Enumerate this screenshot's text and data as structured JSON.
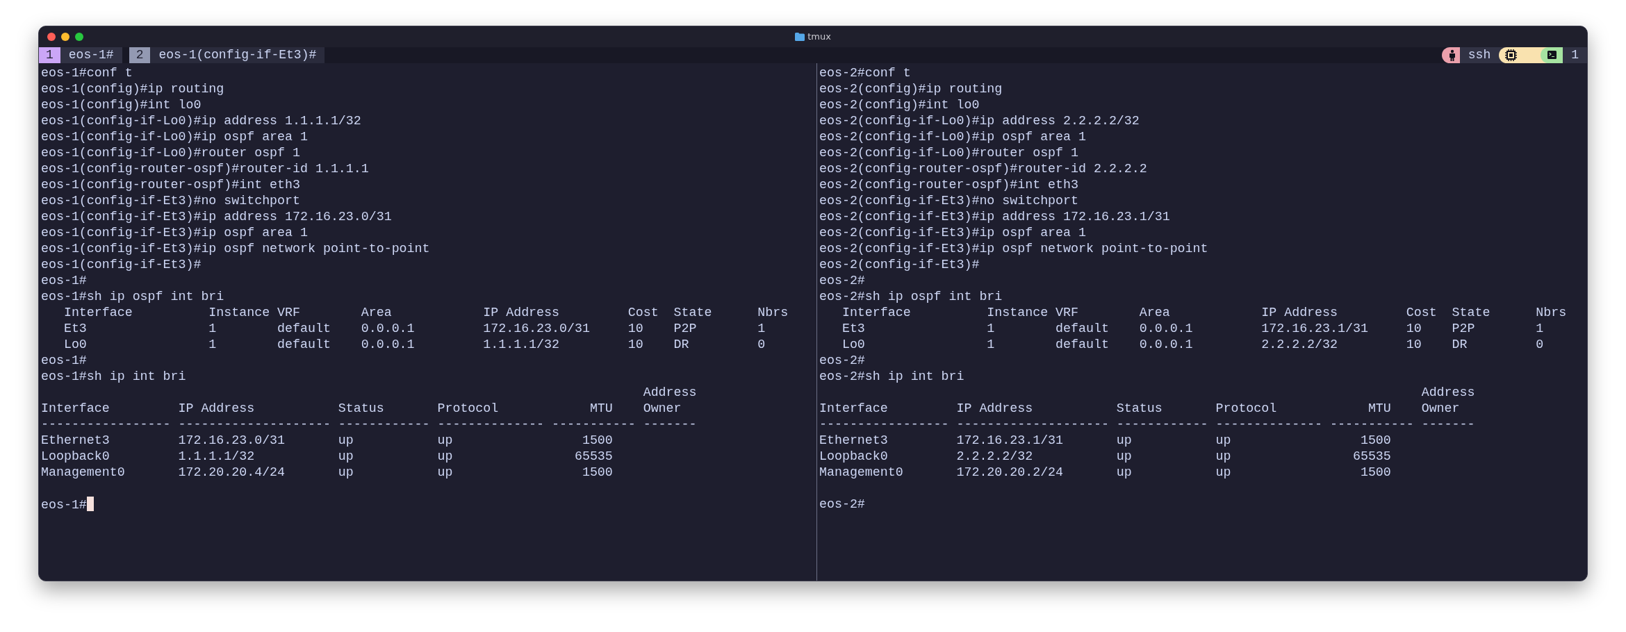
{
  "window": {
    "title": "tmux"
  },
  "tmux_windows": [
    {
      "number": "1",
      "name": "eos-1#",
      "selected": true
    },
    {
      "number": "2",
      "name": "eos-1(config-if-Et3)#",
      "selected": false
    }
  ],
  "status_right": {
    "session": "ssh",
    "pane_count": "1"
  },
  "panes": [
    {
      "cursor": true,
      "lines": [
        {
          "kind": "text",
          "text": "eos-1#conf t"
        },
        {
          "kind": "text",
          "text": "eos-1(config)#ip routing"
        },
        {
          "kind": "text",
          "text": "eos-1(config)#int lo0"
        },
        {
          "kind": "text",
          "text": "eos-1(config-if-Lo0)#ip address 1.1.1.1/32"
        },
        {
          "kind": "text",
          "text": "eos-1(config-if-Lo0)#ip ospf area 1"
        },
        {
          "kind": "text",
          "text": "eos-1(config-if-Lo0)#router ospf 1"
        },
        {
          "kind": "text",
          "text": "eos-1(config-router-ospf)#router-id 1.1.1.1"
        },
        {
          "kind": "text",
          "text": "eos-1(config-router-ospf)#int eth3"
        },
        {
          "kind": "text",
          "text": "eos-1(config-if-Et3)#no switchport"
        },
        {
          "kind": "text",
          "text": "eos-1(config-if-Et3)#ip address 172.16.23.0/31"
        },
        {
          "kind": "text",
          "text": "eos-1(config-if-Et3)#ip ospf area 1"
        },
        {
          "kind": "text",
          "text": "eos-1(config-if-Et3)#ip ospf network point-to-point"
        },
        {
          "kind": "text",
          "text": "eos-1(config-if-Et3)#"
        },
        {
          "kind": "text",
          "text": "eos-1#"
        },
        {
          "kind": "text",
          "text": "eos-1#sh ip ospf int bri"
        },
        {
          "kind": "text",
          "text": "   Interface          Instance VRF        Area            IP Address         Cost  State      Nbrs"
        },
        {
          "kind": "text",
          "text": "   Et3                1        default    0.0.0.1         172.16.23.0/31     10    P2P        1"
        },
        {
          "kind": "text",
          "text": "   Lo0                1        default    0.0.0.1         1.1.1.1/32         10    DR         0"
        },
        {
          "kind": "text",
          "text": "eos-1#"
        },
        {
          "kind": "text",
          "text": "eos-1#sh ip int bri"
        },
        {
          "kind": "text",
          "text": "                                                                               Address"
        },
        {
          "kind": "text",
          "text": "Interface         IP Address           Status       Protocol            MTU    Owner"
        },
        {
          "kind": "text",
          "text": "----------------- -------------------- ------------ -------------- ----------- -------"
        },
        {
          "kind": "text",
          "text": "Ethernet3         172.16.23.0/31       up           up                 1500"
        },
        {
          "kind": "text",
          "text": "Loopback0         1.1.1.1/32           up           up                65535"
        },
        {
          "kind": "text",
          "text": "Management0       172.20.20.4/24       up           up                 1500"
        },
        {
          "kind": "blank"
        },
        {
          "kind": "text",
          "text": "eos-1#"
        }
      ]
    },
    {
      "cursor": false,
      "lines": [
        {
          "kind": "text",
          "text": "eos-2#conf t"
        },
        {
          "kind": "text",
          "text": "eos-2(config)#ip routing"
        },
        {
          "kind": "text",
          "text": "eos-2(config)#int lo0"
        },
        {
          "kind": "text",
          "text": "eos-2(config-if-Lo0)#ip address 2.2.2.2/32"
        },
        {
          "kind": "text",
          "text": "eos-2(config-if-Lo0)#ip ospf area 1"
        },
        {
          "kind": "text",
          "text": "eos-2(config-if-Lo0)#router ospf 1"
        },
        {
          "kind": "text",
          "text": "eos-2(config-router-ospf)#router-id 2.2.2.2"
        },
        {
          "kind": "text",
          "text": "eos-2(config-router-ospf)#int eth3"
        },
        {
          "kind": "text",
          "text": "eos-2(config-if-Et3)#no switchport"
        },
        {
          "kind": "text",
          "text": "eos-2(config-if-Et3)#ip address 172.16.23.1/31"
        },
        {
          "kind": "text",
          "text": "eos-2(config-if-Et3)#ip ospf area 1"
        },
        {
          "kind": "text",
          "text": "eos-2(config-if-Et3)#ip ospf network point-to-point"
        },
        {
          "kind": "text",
          "text": "eos-2(config-if-Et3)#"
        },
        {
          "kind": "text",
          "text": "eos-2#"
        },
        {
          "kind": "text",
          "text": "eos-2#sh ip ospf int bri"
        },
        {
          "kind": "text",
          "text": "   Interface          Instance VRF        Area            IP Address         Cost  State      Nbrs"
        },
        {
          "kind": "text",
          "text": "   Et3                1        default    0.0.0.1         172.16.23.1/31     10    P2P        1"
        },
        {
          "kind": "text",
          "text": "   Lo0                1        default    0.0.0.1         2.2.2.2/32         10    DR         0"
        },
        {
          "kind": "text",
          "text": "eos-2#"
        },
        {
          "kind": "text",
          "text": "eos-2#sh ip int bri"
        },
        {
          "kind": "text",
          "text": "                                                                               Address"
        },
        {
          "kind": "text",
          "text": "Interface         IP Address           Status       Protocol            MTU    Owner"
        },
        {
          "kind": "text",
          "text": "----------------- -------------------- ------------ -------------- ----------- -------"
        },
        {
          "kind": "text",
          "text": "Ethernet3         172.16.23.1/31       up           up                 1500"
        },
        {
          "kind": "text",
          "text": "Loopback0         2.2.2.2/32           up           up                65535"
        },
        {
          "kind": "text",
          "text": "Management0       172.20.20.2/24       up           up                 1500"
        },
        {
          "kind": "blank"
        },
        {
          "kind": "text",
          "text": "eos-2#"
        }
      ]
    }
  ]
}
